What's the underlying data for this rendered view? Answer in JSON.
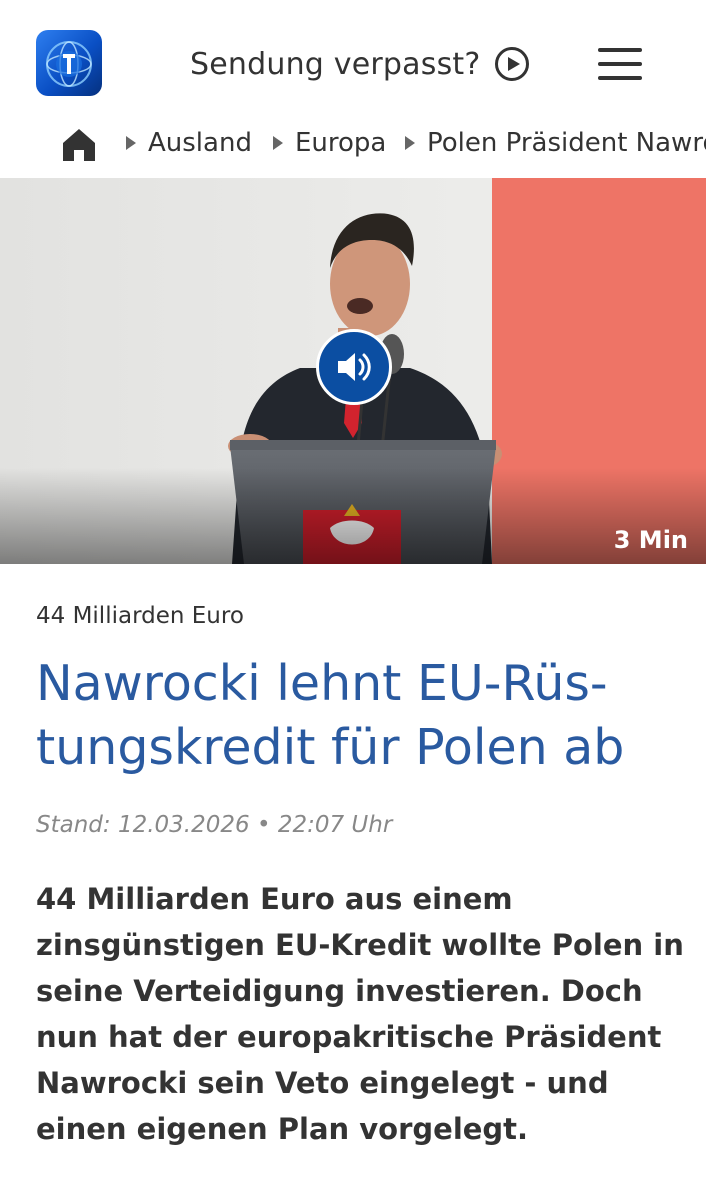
{
  "header": {
    "logo_icon": "tagesschau-globe-logo",
    "sendung_label": "Sendung verpasst?",
    "sendung_icon": "play-circle-icon",
    "menu_icon": "hamburger-menu-icon"
  },
  "breadcrumb": {
    "home_icon": "home-icon",
    "items": [
      {
        "label": "Ausland"
      },
      {
        "label": "Europa"
      },
      {
        "label": "Polen Präsident Nawro"
      }
    ]
  },
  "hero": {
    "audio_icon": "speaker-icon",
    "duration": "3 Min",
    "accent_color": "#0b4ea2"
  },
  "article": {
    "topline": "44 Milliarden Euro",
    "headline": "Nawrocki lehnt EU-Rüs- tungskredit für Polen ab",
    "stand": "Stand: 12.03.2026 • 22:07 Uhr",
    "teaser": "44 Milliarden Euro aus einem zinsgünstigen EU-Kredit wollte Polen in seine Verteidigung investieren. Doch nun hat der europakritische Präsident Nawrocki sein Veto eingelegt - und einen eigenen Plan vorgelegt.",
    "headline_color": "#2a5aa0"
  }
}
